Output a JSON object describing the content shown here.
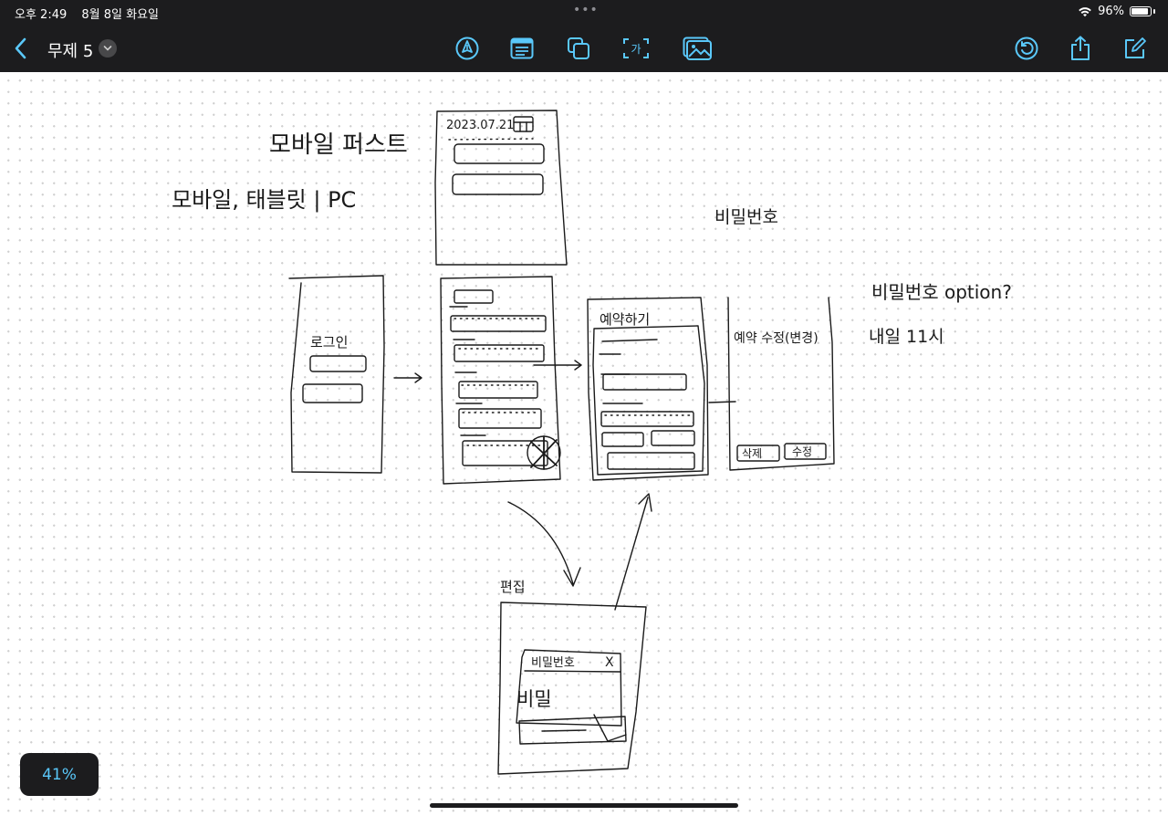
{
  "status_bar": {
    "time": "오후 2:49",
    "date": "8월 8일 화요일",
    "battery": "96%"
  },
  "toolbar": {
    "title": "무제 5",
    "text_tool_label": "가"
  },
  "canvas": {
    "handwriting": {
      "mobile_first": "모바일 퍼스트",
      "devices": "모바일, 태블릿 | PC",
      "date": "2023.07.21",
      "password": "비밀번호",
      "password_option": "비밀번호 option?",
      "tomorrow": "내일 11시",
      "login": "로그인",
      "reservation": "예약하기",
      "reserve_confirm": "예약 수정(변경)",
      "delete": "삭제",
      "modify": "수정",
      "edit": "편집",
      "pw_short": "비밀",
      "close_x": "X"
    }
  },
  "zoom": {
    "level": "41%"
  }
}
